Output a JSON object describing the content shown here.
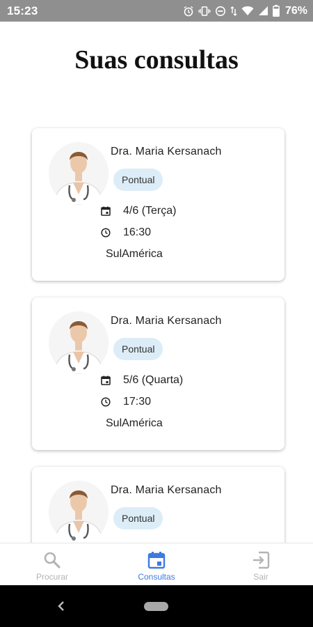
{
  "status_bar": {
    "time": "15:23",
    "battery": "76%",
    "icons": [
      "alarm-icon",
      "vibrate-icon",
      "dnd-icon",
      "data-icon",
      "wifi-icon",
      "signal-icon",
      "battery-icon"
    ]
  },
  "page": {
    "title": "Suas consultas"
  },
  "appointments": [
    {
      "doctor": "Dra. Maria Kersanach",
      "type": "Pontual",
      "date": "4/6 (Terça)",
      "time": "16:30",
      "insurance": "SulAmérica"
    },
    {
      "doctor": "Dra. Maria Kersanach",
      "type": "Pontual",
      "date": "5/6 (Quarta)",
      "time": "17:30",
      "insurance": "SulAmérica"
    },
    {
      "doctor": "Dra. Maria Kersanach",
      "type": "Pontual",
      "date": "",
      "time": "",
      "insurance": ""
    }
  ],
  "bottom_nav": {
    "items": [
      {
        "label": "Procurar",
        "icon": "search-icon",
        "active": false
      },
      {
        "label": "Consultas",
        "icon": "calendar-icon",
        "active": true
      },
      {
        "label": "Sair",
        "icon": "exit-icon",
        "active": false
      }
    ]
  },
  "colors": {
    "accent": "#3d7be0",
    "chip_bg": "#dcedf8",
    "status_bar": "#8f8f8f",
    "nav_inactive": "#b3b3b3"
  }
}
